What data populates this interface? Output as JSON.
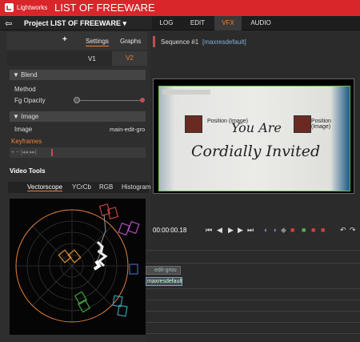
{
  "app": {
    "name": "Lightworks",
    "title": "LIST OF FREEWARE"
  },
  "project": {
    "label": "Project LIST OF FREEWARE ▾"
  },
  "main_tabs": [
    "LOG",
    "EDIT",
    "VFX",
    "AUDIO"
  ],
  "active_tab": "VFX",
  "panel": {
    "add_label": "+",
    "settings_label": "Settings",
    "graphs_label": "Graphs",
    "v1_label": "V1",
    "v2_label": "V2",
    "blend_section": "▼ Blend",
    "method_label": "Method",
    "fg_opacity_label": "Fg Opacity",
    "image_section": "▼ Image",
    "image_label": "Image",
    "image_value": "main-edit-gro",
    "keyframes_label": "Keyframes",
    "keyframe_tools": "+  −  |◂◂  ▸▸|"
  },
  "video_tools": {
    "label": "Video Tools",
    "tabs": [
      "Vectorscope",
      "YCrCb",
      "RGB",
      "Histogram"
    ],
    "active_tab": "Vectorscope"
  },
  "sequence": {
    "name": "Sequence #1",
    "format": "[maxresdefault]"
  },
  "viewer": {
    "line1": "You Are",
    "line2": "Cordially Invited",
    "position_label_left": "Position (Image)",
    "position_label_right": "Position (Image)"
  },
  "transport": {
    "timecode": "00:00:00.18"
  },
  "timeline": {
    "clip_a_label": "edit-grou",
    "clip_b_label": "maxresdefault"
  },
  "colors": {
    "accent": "#f08030",
    "titlebar": "#d8262b"
  }
}
